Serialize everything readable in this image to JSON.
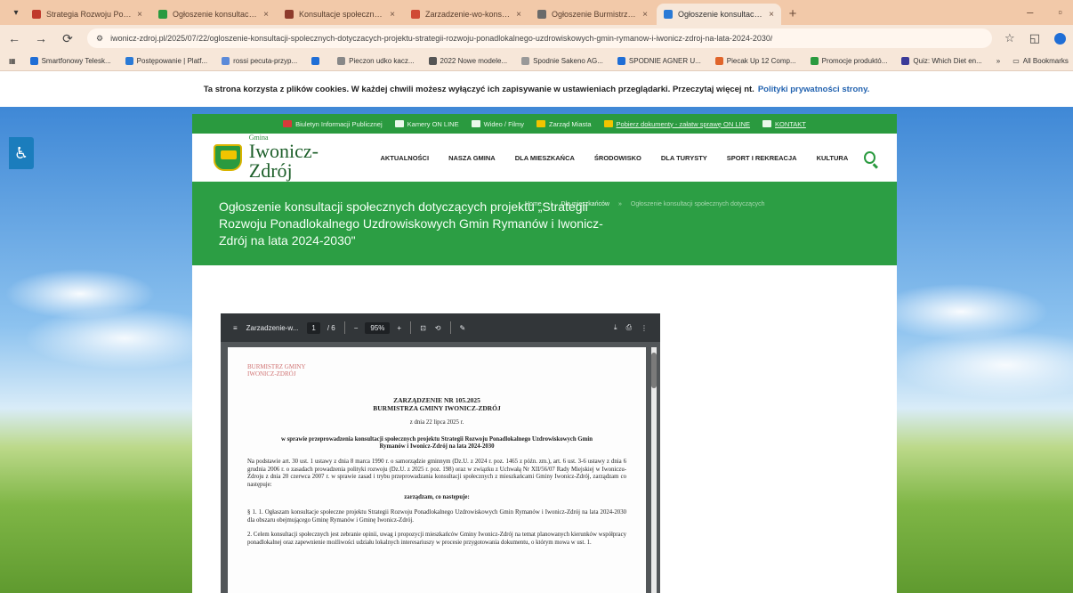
{
  "browser": {
    "tabs": [
      {
        "title": "Strategia Rozwoju Ponadlokalnego",
        "color": "#c0392b",
        "active": false
      },
      {
        "title": "Ogłoszenie konsultacji społecznych",
        "color": "#2a9a3f",
        "active": false
      },
      {
        "title": "Konsultacje społeczne Rymanów",
        "color": "#8e3b2c",
        "active": false
      },
      {
        "title": "Zarzadzenie-wo-konsultacji.pdf",
        "color": "#d04a35",
        "active": false
      },
      {
        "title": "Ogłoszenie Burmistrza Gminy",
        "color": "#6a6a6a",
        "active": false
      },
      {
        "title": "Ogłoszenie konsultacji społecznych",
        "color": "#2a7ad6",
        "active": true
      }
    ],
    "new_tab_icon": "+",
    "url": "iwonicz-zdroj.pl/2025/07/22/ogloszenie-konsultacji-spolecznych-dotyczacych-projektu-strategii-rozwoju-ponadlokalnego-uzdrowiskowych-gmin-rymanow-i-iwonicz-zdroj-na-lata-2024-2030/",
    "bookmarks": [
      {
        "label": "Smartfonowy Telesk...",
        "color": "#1f6ed6"
      },
      {
        "label": "Postępowanie | Platf...",
        "color": "#2a7ad6"
      },
      {
        "label": "rossi pecuta-przyp...",
        "color": "#5b8ad9"
      },
      {
        "label": "",
        "color": "#1f6ed6"
      },
      {
        "label": "Pieczon udko kacz...",
        "color": "#888888"
      },
      {
        "label": "2022 Nowe modele...",
        "color": "#555555"
      },
      {
        "label": "Spodnie Sakeno AG...",
        "color": "#999999"
      },
      {
        "label": "SPODNIE AGNER U...",
        "color": "#1f6ed6"
      },
      {
        "label": "Piecak Up 12 Comp...",
        "color": "#e0652b"
      },
      {
        "label": "Promocje produktó...",
        "color": "#2a9a3f"
      },
      {
        "label": "Quiz: Which Diet en...",
        "color": "#3b3b99"
      }
    ],
    "all_bookmarks": "All Bookmarks"
  },
  "cookie": {
    "text": "Ta strona korzysta z plików cookies. W każdej chwili możesz wyłączyć ich zapisywanie w ustawieniach przeglądarki. Przeczytaj więcej nt.",
    "link": "Polityki prywatności strony."
  },
  "site": {
    "topstrip": [
      {
        "label": "Biuletyn Informacji Publicznej",
        "color": "#d83a3a",
        "link": false
      },
      {
        "label": "Kamery ON LINE",
        "color": "#e9f8ea",
        "link": false
      },
      {
        "label": "Wideo / Filmy",
        "color": "#e9f8ea",
        "link": false
      },
      {
        "label": "Zarząd Miasta",
        "color": "#f1c400",
        "link": false
      },
      {
        "label": "Pobierz dokumenty - załatw sprawę ON LINE",
        "color": "#f1c400",
        "link": true
      },
      {
        "label": "KONTAKT",
        "color": "#e9f8ea",
        "link": true
      }
    ],
    "logo_small": "Gmina",
    "logo_big": "Iwonicz-Zdrój",
    "nav": [
      "AKTUALNOŚCI",
      "NASZA GMINA",
      "DLA MIESZKAŃCA",
      "ŚRODOWISKO",
      "DLA TURYSTY",
      "SPORT I REKREACJA",
      "KULTURA"
    ],
    "title": "Ogłoszenie konsultacji społecznych dotyczących projektu „Strategii Rozwoju Ponadlokalnego Uzdrowiskowych Gmin Rymanów i Iwonicz-Zdrój na lata 2024-2030\"",
    "breadcrumbs": [
      "Home",
      "Dla mieszkańców",
      "Ogłoszenie konsultacji społecznych dotyczących"
    ]
  },
  "pdf": {
    "filename": "Zarzadzenie-w...",
    "page": "1",
    "pages": "/ 6",
    "zoom": "95%",
    "stamp": "BURMISTRZ GMINY\nIWONICZ-ZDRÓJ",
    "doc_title": "ZARZĄDZENIE NR 105.2025\nBURMISTRZA GMINY IWONICZ-ZDRÓJ",
    "doc_date": "z dnia 22 lipca 2025 r.",
    "doc_subject": "w sprawie przeprowadzenia konsultacji społecznych projektu Strategii Rozwoju Ponadlokalnego Uzdrowiskowych Gmin Rymanów i Iwonicz-Zdrój na lata 2024-2030",
    "doc_p1": "Na podstawie art. 30 ust. 1 ustawy z dnia 8 marca 1990 r. o samorządzie gminnym (Dz.U. z 2024 r. poz. 1465 z późn. zm.), art. 6 ust. 3-6 ustawy z dnia 6 grudnia 2006 r. o zasadach prowadzenia polityki rozwoju (Dz.U. z 2025 r. poz. 198) oraz w związku z Uchwałą Nr XII/56/07 Rady Miejskiej w Iwoniczu-Zdroju z dnia 20 czerwca 2007 r. w sprawie zasad i trybu przeprowadzania konsultacji społecznych z mieszkańcami Gminy Iwonicz-Zdrój, zarządzam co następuje:",
    "doc_c": "zarządzam, co następuje:",
    "doc_p2": "§ 1. 1. Ogłaszam konsultacje społeczne projektu Strategii Rozwoju Ponadlokalnego Uzdrowiskowych Gmin Rymanów i Iwonicz-Zdrój na lata 2024-2030 dla obszaru obejmującego Gminę Rymanów i Gminę Iwonicz-Zdrój.",
    "doc_p3": "2. Celem konsultacji społecznych jest zebranie opinii, uwag i propozycji mieszkańców Gminy Iwonicz-Zdrój na temat planowanych kierunków współpracy ponadlokalnej oraz zapewnienie możliwości udziału lokalnych interesariuszy w procesie przygotowania dokumentu, o którym mowa w ust. 1."
  }
}
